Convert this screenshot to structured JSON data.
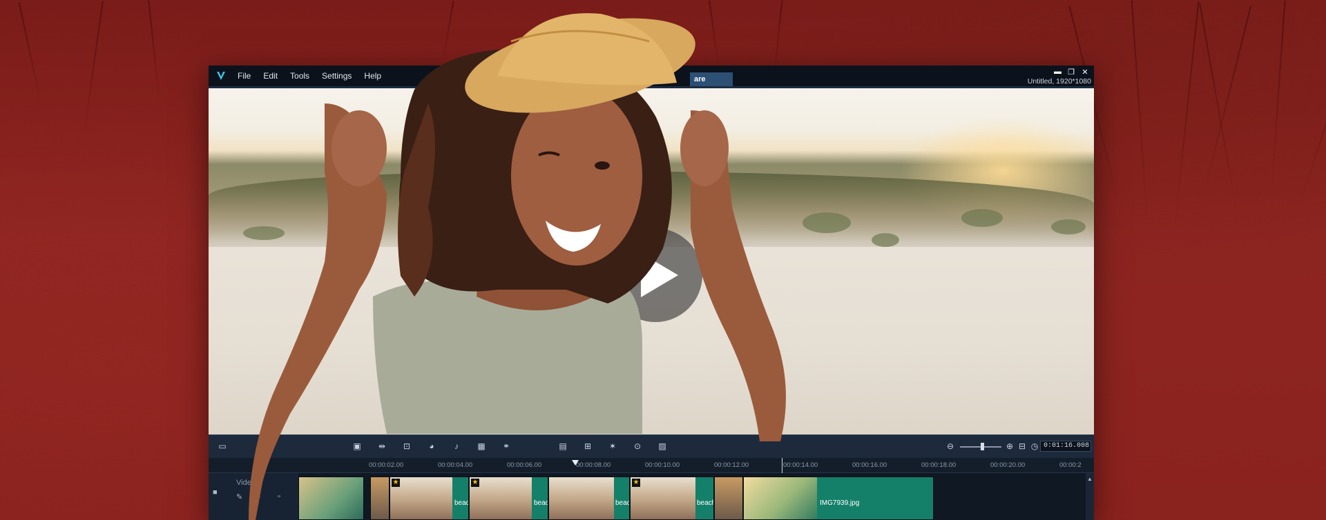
{
  "menu": {
    "items": [
      "File",
      "Edit",
      "Tools",
      "Settings",
      "Help"
    ]
  },
  "tabs": {
    "share_label": "are"
  },
  "project": {
    "info": "Untitled, 1920*1080"
  },
  "window_controls": {
    "minimize": "▬",
    "restore": "❐",
    "close": "✕"
  },
  "toolbar": {
    "timecode": "0:01:16.008"
  },
  "ruler": {
    "labels": [
      "00:00:02.00",
      "00:00:04.00",
      "00:00:06.00",
      "00:00:08.00",
      "00:00:10.00",
      "00:00:12.00",
      "00:00:14.00",
      "00:00:16.00",
      "00:00:18.00",
      "00:00:20.00",
      "00:00:2"
    ]
  },
  "track": {
    "name": "Video"
  },
  "clips": [
    {
      "label": "beach-c"
    },
    {
      "label": "beach"
    },
    {
      "label": "beach-c"
    },
    {
      "label": "beach-c"
    },
    {
      "label": "IMG7939.jpg"
    }
  ],
  "colors": {
    "accent": "#3fc5e6",
    "clip_teal": "#15806a",
    "background_red": "#8a221e",
    "share_tab": "#2c4f74"
  }
}
